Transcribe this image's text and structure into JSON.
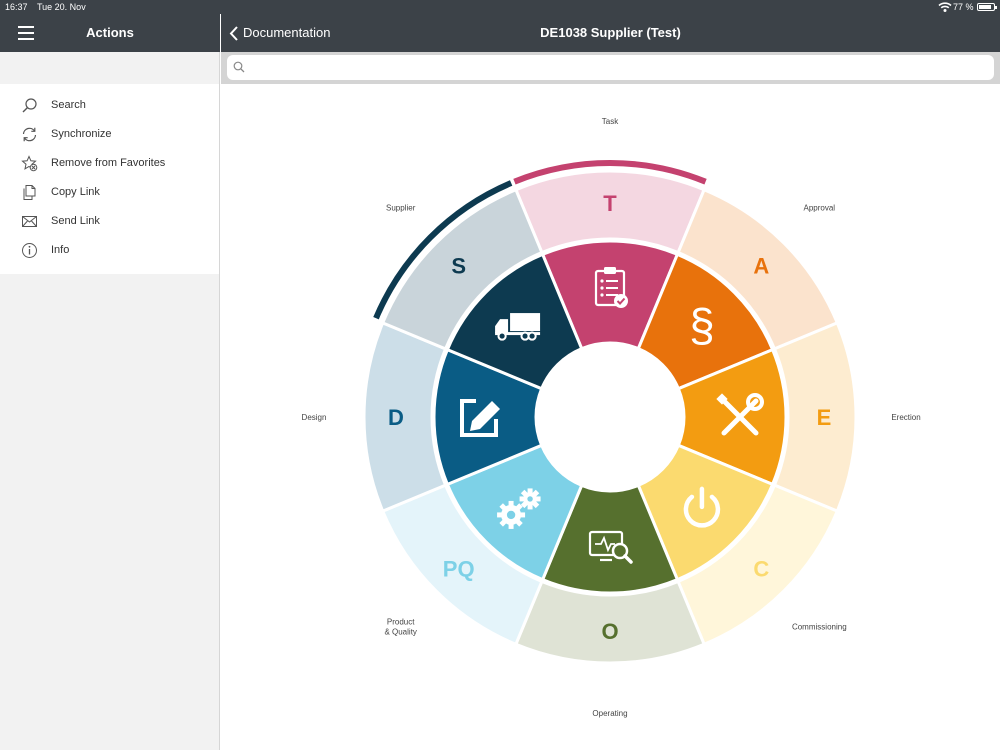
{
  "status": {
    "time": "16:37",
    "date": "Tue 20. Nov",
    "battery": "77 %",
    "battery_level": 0.77
  },
  "sidebar": {
    "title": "Actions",
    "items": [
      {
        "label": "Search",
        "icon": "search-icon"
      },
      {
        "label": "Synchronize",
        "icon": "sync-icon"
      },
      {
        "label": "Remove from Favorites",
        "icon": "star-remove-icon"
      },
      {
        "label": "Copy Link",
        "icon": "copy-icon"
      },
      {
        "label": "Send Link",
        "icon": "mail-icon"
      },
      {
        "label": "Info",
        "icon": "info-icon"
      }
    ]
  },
  "header": {
    "back_label": "Documentation",
    "title": "DE1038 Supplier (Test)"
  },
  "search": {
    "placeholder": "",
    "value": ""
  },
  "wheel": {
    "segments": [
      {
        "letter": "T",
        "label": "Task",
        "icon": "clipboard-check-icon",
        "inner": "#c4426f",
        "outer": "#f4d7e1",
        "letter_color": "#c4426f",
        "highlight": "#c4426f"
      },
      {
        "letter": "A",
        "label": "Approval",
        "icon": "paragraph-icon",
        "inner": "#e8720c",
        "outer": "#fbe3cd",
        "letter_color": "#e8720c",
        "highlight": ""
      },
      {
        "letter": "E",
        "label": "Erection",
        "icon": "tools-icon",
        "inner": "#f39c11",
        "outer": "#fdecd0",
        "letter_color": "#f39c11",
        "highlight": ""
      },
      {
        "letter": "C",
        "label": "Commissioning",
        "icon": "power-icon",
        "inner": "#fbda6f",
        "outer": "#fff6da",
        "letter_color": "#fbda6f",
        "highlight": ""
      },
      {
        "letter": "O",
        "label": "Operating",
        "icon": "monitor-search-icon",
        "inner": "#56702e",
        "outer": "#dfe3d5",
        "letter_color": "#56702e",
        "highlight": ""
      },
      {
        "letter": "PQ",
        "label": "Product\n& Quality",
        "icon": "gears-icon",
        "inner": "#7dd1e7",
        "outer": "#e4f4fa",
        "letter_color": "#7dd1e7",
        "highlight": ""
      },
      {
        "letter": "D",
        "label": "Design",
        "icon": "edit-icon",
        "inner": "#0a5c85",
        "outer": "#ccdee8",
        "letter_color": "#0a5c85",
        "highlight": ""
      },
      {
        "letter": "S",
        "label": "Supplier",
        "icon": "truck-icon",
        "inner": "#0d3a50",
        "outer": "#c9d4da",
        "letter_color": "#0d3a50",
        "highlight": "#0d3a50"
      }
    ]
  }
}
